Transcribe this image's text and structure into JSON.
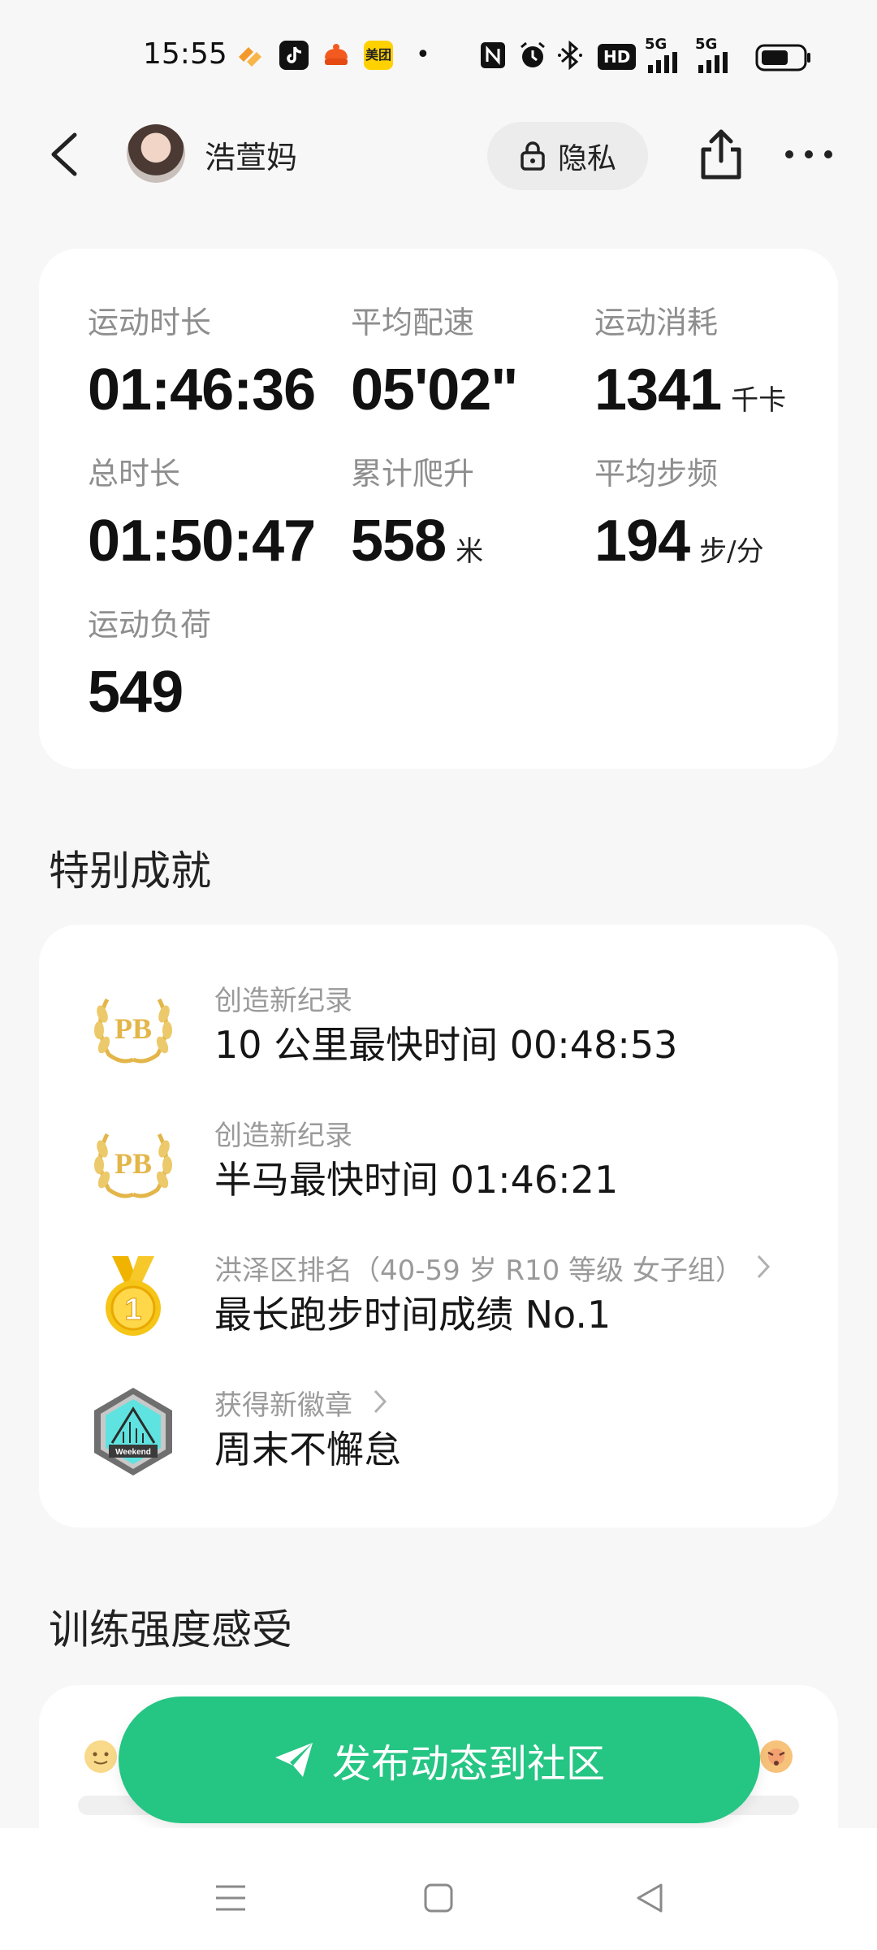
{
  "status_bar": {
    "time": "15:55",
    "app_icons": [
      "hotel-app-icon",
      "tiktok-icon",
      "taobao-icon",
      "meituan-icon"
    ],
    "meituan_label": "美团",
    "dot": "•",
    "system_icons": [
      "nfc-icon",
      "alarm-icon",
      "bluetooth-icon",
      "hd-icon",
      "signal-5g-icon",
      "signal-5g-icon",
      "battery-icon"
    ],
    "hd_label": "HD",
    "net_label_1": "5G",
    "net_label_2": "5G"
  },
  "header": {
    "user_name": "浩萱妈",
    "privacy_label": "隐私"
  },
  "stats": [
    {
      "label": "运动时长",
      "value": "01:46:36",
      "unit": ""
    },
    {
      "label": "平均配速",
      "value": "05'02\"",
      "unit": ""
    },
    {
      "label": "运动消耗",
      "value": "1341",
      "unit": "千卡"
    },
    {
      "label": "总时长",
      "value": "01:50:47",
      "unit": ""
    },
    {
      "label": "累计爬升",
      "value": "558",
      "unit": "米"
    },
    {
      "label": "平均步频",
      "value": "194",
      "unit": "步/分"
    },
    {
      "label": "运动负荷",
      "value": "549",
      "unit": ""
    }
  ],
  "achievements": {
    "title": "特别成就",
    "items": [
      {
        "icon": "pb-laurel-icon",
        "subtitle": "创造新纪录",
        "main": "10 公里最快时间 00:48:53"
      },
      {
        "icon": "pb-laurel-icon",
        "subtitle": "创造新纪录",
        "main": "半马最快时间 01:46:21"
      },
      {
        "icon": "gold-medal-icon",
        "subtitle": "洪泽区排名（40-59 岁 R10 等级 女子组）",
        "main": "最长跑步时间成绩 No.1"
      },
      {
        "icon": "weekend-badge-icon",
        "subtitle": "获得新徽章",
        "main": "周末不懈怠"
      }
    ],
    "pb_text": "PB",
    "medal_text": "1",
    "badge_text": "Weekend"
  },
  "intensity": {
    "title": "训练强度感受"
  },
  "publish": {
    "label": "发布动态到社区"
  },
  "colors": {
    "accent_green": "#25c583",
    "gold": "#e3b64a",
    "muted_text": "#8e8e8e"
  }
}
